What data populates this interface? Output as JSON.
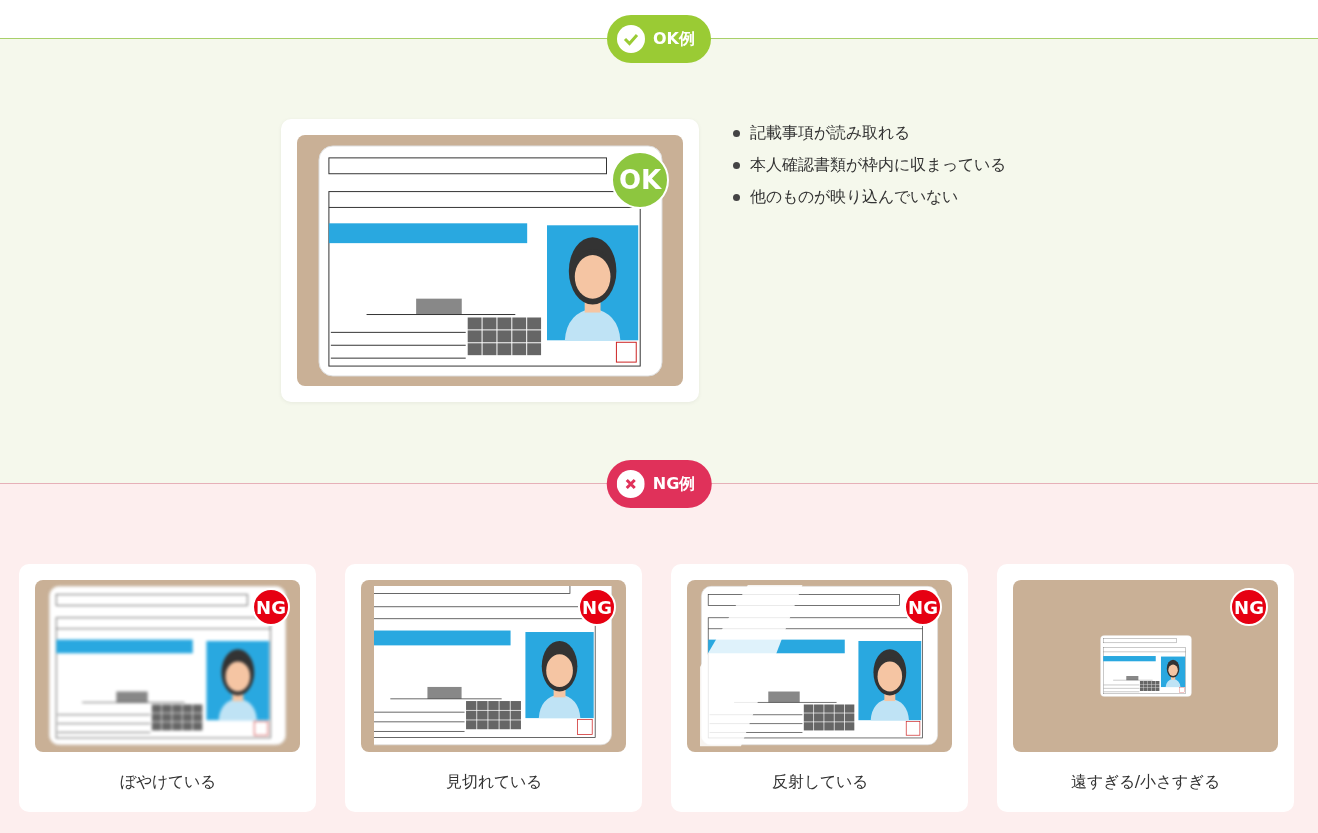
{
  "ok_section": {
    "label": "OK例",
    "sample": {
      "badge": "OK"
    },
    "points": [
      "記載事項が読み取れる",
      "本人確認書類が枠内に収まっている",
      "他のものが映り込んでいない"
    ]
  },
  "ng_section": {
    "label": "NG例",
    "examples": [
      {
        "kind": "blurry",
        "badge": "NG",
        "caption": "ぼやけている"
      },
      {
        "kind": "cropped",
        "badge": "NG",
        "caption": "見切れている"
      },
      {
        "kind": "glare",
        "badge": "NG",
        "caption": "反射している"
      },
      {
        "kind": "small",
        "badge": "NG",
        "caption": "遠すぎる/小さすぎる"
      }
    ]
  }
}
